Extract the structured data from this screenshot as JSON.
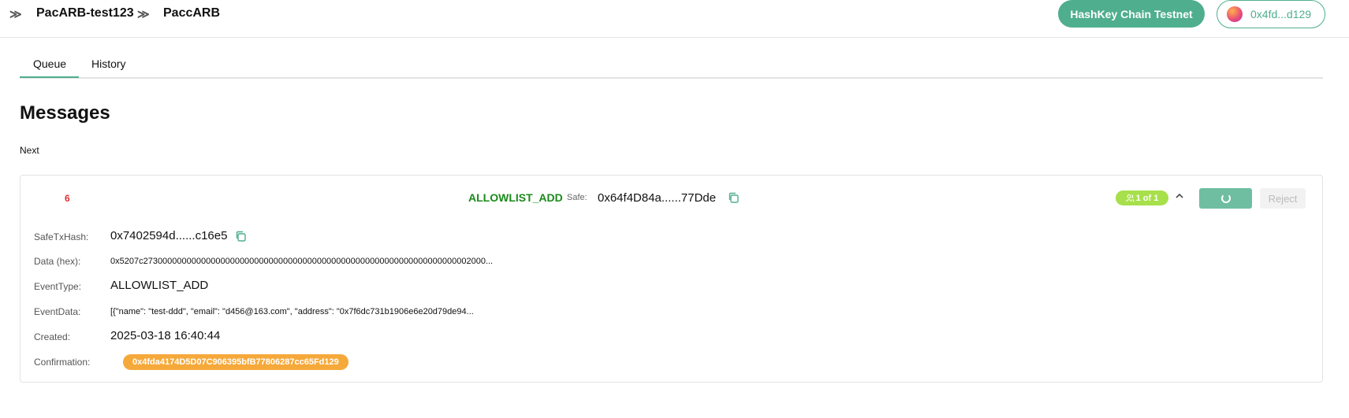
{
  "breadcrumb": {
    "items": [
      "PacARB-test123",
      "PaccARB"
    ],
    "separator": "≫"
  },
  "header": {
    "network_label": "HashKey Chain Testnet",
    "wallet_label": "0x4fd...d129"
  },
  "tabs": [
    {
      "label": "Queue",
      "active": true
    },
    {
      "label": "History",
      "active": false
    }
  ],
  "page": {
    "title": "Messages",
    "section_label": "Next"
  },
  "message": {
    "nonce": "6",
    "event_type": "ALLOWLIST_ADD",
    "safe_label": "Safe:",
    "safe_address": "0x64f4D84a......77Dde",
    "confirmations_badge": "1 of 1",
    "reject_label": "Reject",
    "details": {
      "safe_tx_hash_label": "SafeTxHash:",
      "safe_tx_hash": "0x7402594d......c16e5",
      "data_label": "Data (hex):",
      "data_value": "0x5207c27300000000000000000000000000000000000000000000000000000000000000002000...",
      "event_type_label": "EventType:",
      "event_type_value": "ALLOWLIST_ADD",
      "event_data_label": "EventData:",
      "event_data_value": "[{\"name\": \"test-ddd\", \"email\": \"d456@163.com\", \"address\": \"0x7f6dc731b1906e6e20d79de94...",
      "created_label": "Created:",
      "created_value": "2025-03-18 16:40:44",
      "confirmation_label": "Confirmation:",
      "confirmation_value": "0x4fda4174D5D07C906395bfB77806287cc65Fd129"
    }
  },
  "colors": {
    "accent": "#4fae8e",
    "event_type": "#1a8a1a",
    "nonce": "#dd3333",
    "badge": "#a7e04a",
    "confirmation_chip": "#f5a93a"
  },
  "icons": [
    "breadcrumb-separator-icon",
    "wallet-avatar-icon",
    "copy-icon",
    "signers-icon",
    "chevron-up-icon",
    "spinner-icon"
  ]
}
